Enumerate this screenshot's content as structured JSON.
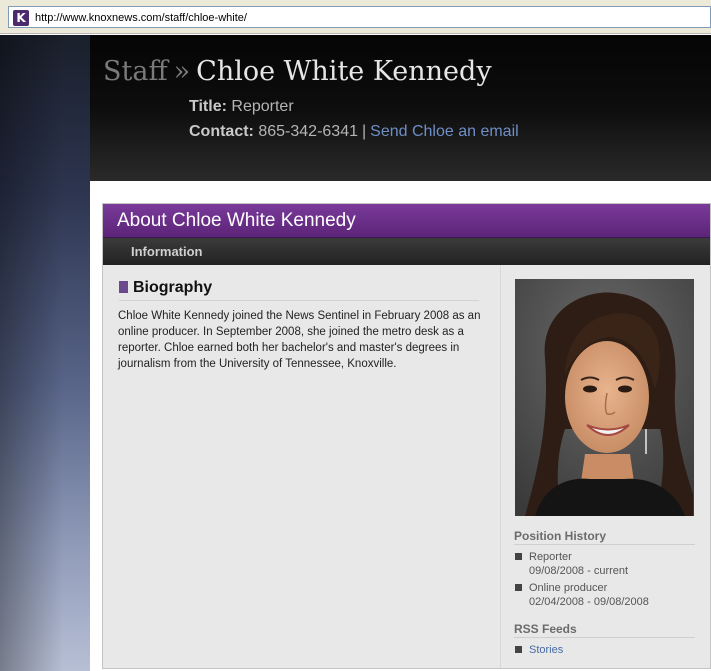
{
  "browser": {
    "url": "http://www.knoxnews.com/staff/chloe-white/",
    "favicon_glyph": "K"
  },
  "header": {
    "breadcrumb_root": "Staff",
    "breadcrumb_sep": "»",
    "name": "Chloe White Kennedy",
    "title_label": "Title:",
    "title_value": "Reporter",
    "contact_label": "Contact:",
    "phone": "865-342-6341",
    "pipe": "|",
    "email_link": "Send Chloe an email"
  },
  "panel": {
    "about_title": "About Chloe White Kennedy",
    "info_tab": "Information",
    "bio_heading": "Biography",
    "bio_text": "Chloe White Kennedy joined the News Sentinel in February 2008 as an online producer. In September 2008, she joined the metro desk as a reporter. Chloe earned both her bachelor's and master's degrees in journalism from the University of Tennessee, Knoxville."
  },
  "sidebar": {
    "position_history_heading": "Position History",
    "positions": [
      {
        "role": "Reporter",
        "dates": "09/08/2008 - current"
      },
      {
        "role": "Online producer",
        "dates": "02/04/2008 - 09/08/2008"
      }
    ],
    "rss_heading": "RSS Feeds",
    "rss_items": [
      {
        "label": "Stories"
      }
    ]
  },
  "colors": {
    "about_bar": "#6a2e8a",
    "link": "#6e8fc6",
    "header_bg": "#0a0a0a"
  }
}
